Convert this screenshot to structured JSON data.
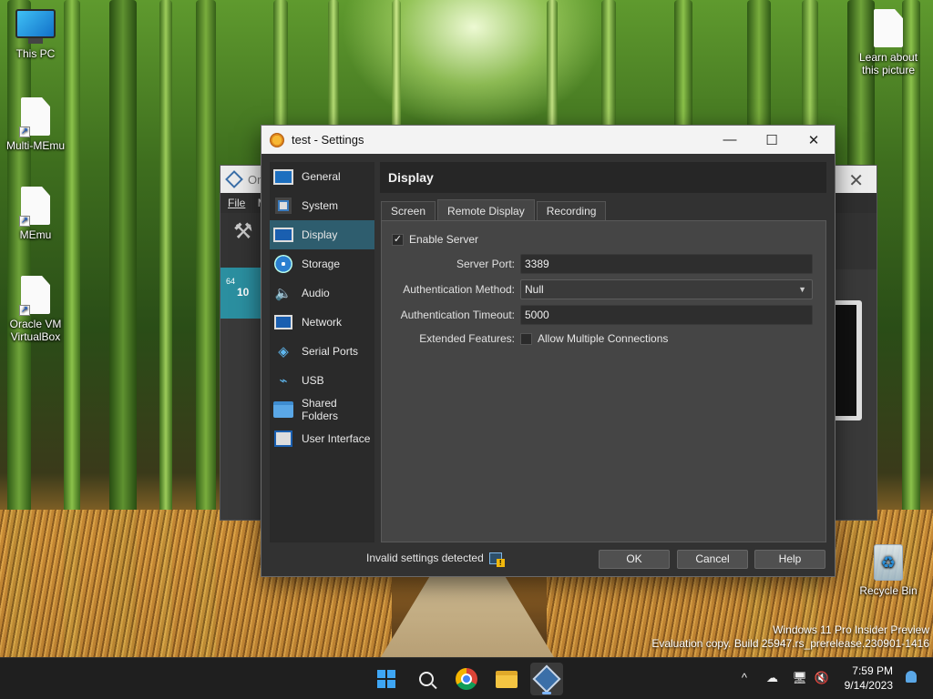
{
  "desktop": {
    "icons": [
      {
        "label": "This PC",
        "icon": "monitor-icon"
      },
      {
        "label": "Multi-MEmu",
        "icon": "shortcut-file-icon"
      },
      {
        "label": "MEmu",
        "icon": "shortcut-file-icon"
      },
      {
        "label": "Oracle VM VirtualBox",
        "icon": "shortcut-file-icon"
      },
      {
        "label": "Learn about this picture",
        "icon": "file-icon"
      },
      {
        "label": "Recycle Bin",
        "icon": "recycle-bin-icon"
      }
    ],
    "watermark": {
      "line1": "Windows 11 Pro Insider Preview",
      "line2": "Evaluation copy. Build 25947.rs_prerelease.230901-1416"
    }
  },
  "background_window": {
    "title_partial": "Or",
    "menu": [
      "File",
      "M"
    ],
    "vm_badge": "64",
    "vm_number": "10"
  },
  "settings": {
    "window_title": "test - Settings",
    "window_controls": {
      "minimize": "—",
      "maximize": "☐",
      "close": "✕"
    },
    "sidebar": [
      {
        "label": "General",
        "icon": "general-icon"
      },
      {
        "label": "System",
        "icon": "system-icon"
      },
      {
        "label": "Display",
        "icon": "display-icon",
        "active": true
      },
      {
        "label": "Storage",
        "icon": "storage-icon"
      },
      {
        "label": "Audio",
        "icon": "audio-icon"
      },
      {
        "label": "Network",
        "icon": "network-icon"
      },
      {
        "label": "Serial Ports",
        "icon": "serial-ports-icon"
      },
      {
        "label": "USB",
        "icon": "usb-icon"
      },
      {
        "label": "Shared Folders",
        "icon": "shared-folders-icon"
      },
      {
        "label": "User Interface",
        "icon": "user-interface-icon"
      }
    ],
    "page_title": "Display",
    "tabs": [
      {
        "label": "Screen"
      },
      {
        "label": "Remote Display",
        "active": true
      },
      {
        "label": "Recording"
      }
    ],
    "remote_display": {
      "enable_server_label": "Enable Server",
      "enable_server_checked": true,
      "server_port_label": "Server Port:",
      "server_port_value": "3389",
      "auth_method_label": "Authentication Method:",
      "auth_method_value": "Null",
      "auth_timeout_label": "Authentication Timeout:",
      "auth_timeout_value": "5000",
      "extended_features_label": "Extended Features:",
      "allow_multiple_label": "Allow Multiple Connections",
      "allow_multiple_checked": false
    },
    "footer": {
      "status_text": "Invalid settings detected",
      "ok": "OK",
      "cancel": "Cancel",
      "help": "Help"
    }
  },
  "taskbar": {
    "apps": [
      {
        "name": "start",
        "icon": "windows-icon"
      },
      {
        "name": "search",
        "icon": "search-icon"
      },
      {
        "name": "chrome",
        "icon": "chrome-icon"
      },
      {
        "name": "file-explorer",
        "icon": "folder-icon"
      },
      {
        "name": "virtualbox",
        "icon": "virtualbox-icon",
        "active": true
      }
    ],
    "tray": {
      "chevron": "^",
      "time": "7:59 PM",
      "date": "9/14/2023"
    }
  },
  "colors": {
    "accent": "#2e5d6e",
    "dialog_bg": "#323232",
    "panel_bg": "#454545"
  }
}
